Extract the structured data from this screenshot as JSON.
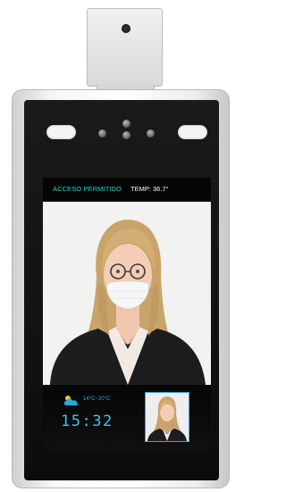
{
  "device": {
    "icons": [
      "thermal-sensor",
      "camera-icon",
      "weather-cloud-icon"
    ]
  },
  "status_bar": {
    "access_message": "ACCESO PERMITIDO",
    "temperature_label": "TEMP:",
    "temperature_value": "36.7°"
  },
  "info": {
    "weather_range": "14°C~20°C",
    "clock": "15:32"
  },
  "colors": {
    "accent_teal": "#20d7c9",
    "clock_blue": "#3ac3e8",
    "frame_black": "#111111"
  }
}
